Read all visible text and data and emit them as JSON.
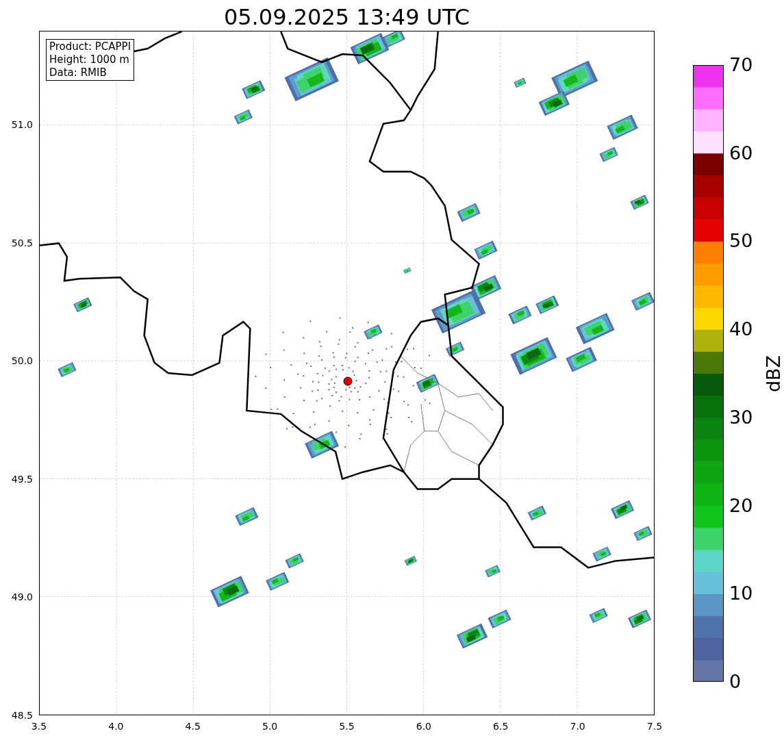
{
  "title": "05.09.2025 13:49 UTC",
  "info_box": [
    "Product: PCAPPI",
    "Height: 1000 m",
    "Data: RMIB"
  ],
  "x_ticks": [
    "3.5",
    "4.0",
    "4.5",
    "5.0",
    "5.5",
    "6.0",
    "6.5",
    "7.0",
    "7.5"
  ],
  "y_ticks": [
    "51.0",
    "50.5",
    "50.0",
    "49.5",
    "49.0",
    "48.5"
  ],
  "colorbar": {
    "label": "dBZ",
    "ticks": [
      "70",
      "60",
      "50",
      "40",
      "30",
      "20",
      "10",
      "0"
    ]
  }
}
